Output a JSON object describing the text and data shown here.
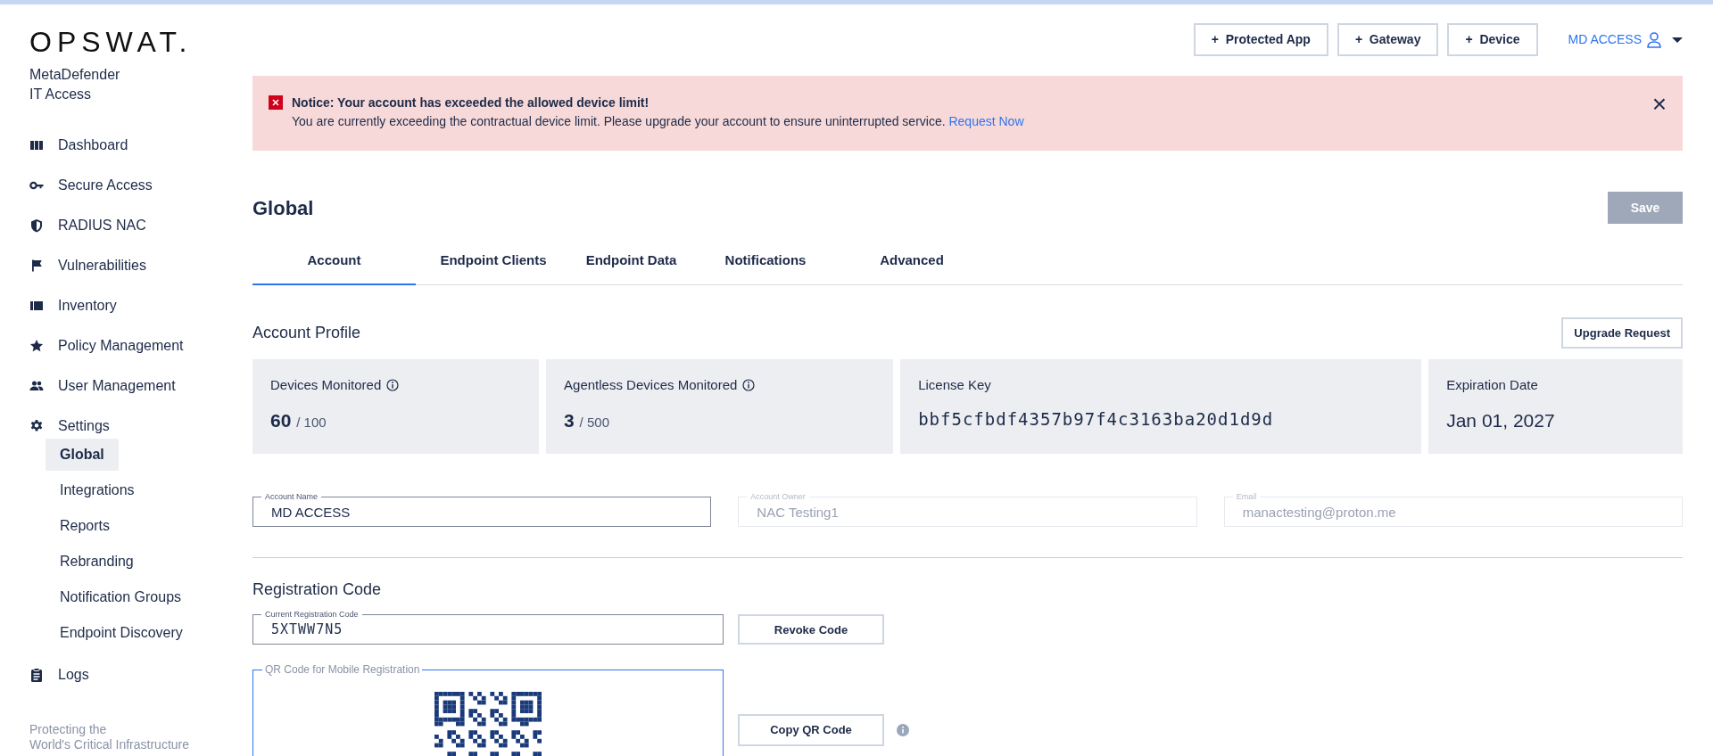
{
  "sidebar": {
    "logo": "OPSWAT.",
    "product": [
      "MetaDefender",
      "IT Access"
    ],
    "items": [
      {
        "label": "Dashboard",
        "selected": false
      },
      {
        "label": "Secure Access",
        "selected": false
      },
      {
        "label": "RADIUS NAC",
        "selected": false
      },
      {
        "label": "Vulnerabilities",
        "selected": false
      },
      {
        "label": "Inventory",
        "selected": false
      },
      {
        "label": "Policy Management",
        "selected": false
      },
      {
        "label": "User Management",
        "selected": false
      },
      {
        "label": "Settings",
        "selected": false,
        "children": [
          {
            "label": "Global",
            "selected": true
          },
          {
            "label": "Integrations",
            "selected": false
          },
          {
            "label": "Reports",
            "selected": false
          },
          {
            "label": "Rebranding",
            "selected": false
          },
          {
            "label": "Notification Groups",
            "selected": false
          },
          {
            "label": "Endpoint Discovery",
            "selected": false
          }
        ]
      },
      {
        "label": "Logs",
        "selected": false
      }
    ],
    "footer": [
      "Protecting the",
      "World's Critical Infrastructure"
    ]
  },
  "header": {
    "buttons": [
      "Protected App",
      "Gateway",
      "Device"
    ],
    "plus": "+",
    "user": "MD ACCESS"
  },
  "notice": {
    "title": "Notice: Your account has exceeded the allowed device limit!",
    "message": "You are currently exceeding the contractual device limit. Please upgrade your account to ensure uninterrupted service.",
    "link": "Request Now",
    "close": "×"
  },
  "page": {
    "title": "Global",
    "save": {
      "label": "Save",
      "disabled": true
    }
  },
  "tabs": [
    {
      "label": "Account",
      "selected": true
    },
    {
      "label": "Endpoint Clients",
      "selected": false
    },
    {
      "label": "Endpoint Data",
      "selected": false
    },
    {
      "label": "Notifications",
      "selected": false
    },
    {
      "label": "Advanced",
      "selected": false
    }
  ],
  "account_profile": {
    "title": "Account Profile",
    "button": "Upgrade Request",
    "stats": [
      {
        "kind": "count",
        "label": "Devices Monitored",
        "value": "60",
        "total": "/ 100"
      },
      {
        "kind": "count",
        "label": "Agentless Devices Monitored",
        "value": "3",
        "total": "/ 500"
      },
      {
        "kind": "key",
        "label": "License Key",
        "value": "bbf5cfbdf4357b97f4c3163ba20d1d9d"
      },
      {
        "kind": "date",
        "label": "Expiration Date",
        "value": "Jan 01, 2027"
      }
    ],
    "fields": [
      {
        "label": "Account Name",
        "value": "MD ACCESS",
        "disabled": false
      },
      {
        "label": "Account Owner",
        "value": "NAC Testing1",
        "disabled": true
      },
      {
        "label": "Email",
        "value": "manactesting@proton.me",
        "disabled": true
      }
    ]
  },
  "registration": {
    "title": "Registration Code",
    "code_label": "Current Registration Code",
    "code": "5XTWW7N5",
    "revoke": "Revoke Code",
    "qr_label": "QR Code for Mobile Registration",
    "copy": "Copy QR Code"
  }
}
